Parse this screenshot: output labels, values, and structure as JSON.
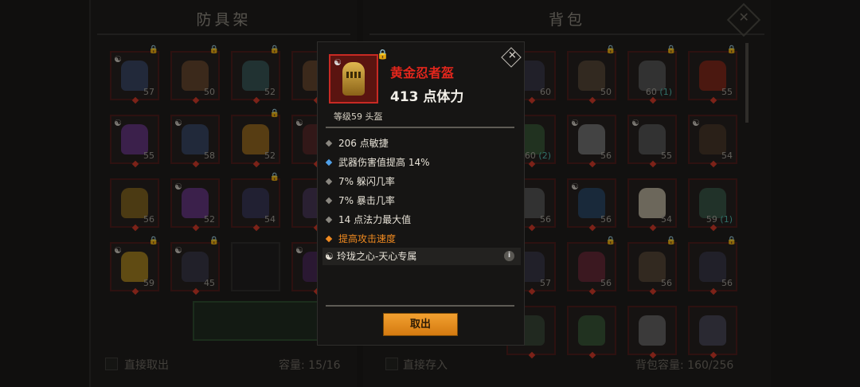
{
  "left_panel": {
    "title": "防具架",
    "footer_checkbox_label": "直接取出",
    "capacity": "容量: 15/16",
    "slots": [
      {
        "level": "57",
        "color": "#3c4a6a",
        "yy": true,
        "lock": true
      },
      {
        "level": "50",
        "color": "#6a4a30",
        "yy": false,
        "lock": true
      },
      {
        "level": "52",
        "color": "#3a5a5a",
        "yy": false,
        "lock": true
      },
      {
        "level": "",
        "color": "#6a4a30",
        "yy": false,
        "lock": true
      },
      {
        "level": "55",
        "color": "#6a3a8a",
        "yy": true,
        "lock": false
      },
      {
        "level": "58",
        "color": "#3a4a6a",
        "yy": true,
        "lock": false
      },
      {
        "level": "52",
        "color": "#a07020",
        "yy": false,
        "lock": true
      },
      {
        "level": "",
        "color": "#5a2a2a",
        "yy": true,
        "lock": false
      },
      {
        "level": "56",
        "color": "#8a6a20",
        "yy": false,
        "lock": false
      },
      {
        "level": "52",
        "color": "#6a3a8a",
        "yy": true,
        "lock": false
      },
      {
        "level": "54",
        "color": "#3a3a5a",
        "yy": false,
        "lock": true
      },
      {
        "level": "",
        "color": "#4a3a5a",
        "yy": false,
        "lock": false
      },
      {
        "level": "59",
        "color": "#b08a20",
        "yy": true,
        "lock": true
      },
      {
        "level": "45",
        "color": "#3a3a4a",
        "yy": true,
        "lock": true
      },
      {
        "level": "",
        "color": "",
        "yy": false,
        "lock": false
      },
      {
        "level": "",
        "color": "#4a2a5a",
        "yy": true,
        "lock": false
      }
    ]
  },
  "right_panel": {
    "title": "背包",
    "footer_checkbox_label": "直接存入",
    "capacity": "背包容量: 160/256",
    "slots": [
      {
        "level": "60",
        "extra": "",
        "color": "#3a3a4a",
        "yy": false,
        "lock": false
      },
      {
        "level": "50",
        "extra": "",
        "color": "#5a4a3a",
        "yy": false,
        "lock": true
      },
      {
        "level": "60",
        "extra": "(1)",
        "color": "#5a5a5a",
        "yy": false,
        "lock": true
      },
      {
        "level": "55",
        "extra": "",
        "color": "#8a2a1a",
        "yy": false,
        "lock": true
      },
      {
        "level": "60",
        "extra": "(2)",
        "color": "#3a5a3a",
        "yy": false,
        "lock": false
      },
      {
        "level": "56",
        "extra": "",
        "color": "#7a7a7a",
        "yy": true,
        "lock": false
      },
      {
        "level": "55",
        "extra": "",
        "color": "#5a5a5a",
        "yy": true,
        "lock": false
      },
      {
        "level": "54",
        "extra": "",
        "color": "#4a3a2a",
        "yy": true,
        "lock": false
      },
      {
        "level": "56",
        "extra": "",
        "color": "#5a5a5a",
        "yy": false,
        "lock": false
      },
      {
        "level": "56",
        "extra": "",
        "color": "#2a4a6a",
        "yy": true,
        "lock": false
      },
      {
        "level": "54",
        "extra": "",
        "color": "#c8c0a8",
        "yy": false,
        "lock": false
      },
      {
        "level": "59",
        "extra": "(1)",
        "color": "#3a5a4a",
        "yy": false,
        "lock": false
      },
      {
        "level": "57",
        "extra": "",
        "color": "#3a3a4a",
        "yy": false,
        "lock": false
      },
      {
        "level": "56",
        "extra": "",
        "color": "#6a2a3a",
        "yy": false,
        "lock": true
      },
      {
        "level": "56",
        "extra": "",
        "color": "#5a4a3a",
        "yy": false,
        "lock": true
      },
      {
        "level": "56",
        "extra": "",
        "color": "#3a3a4a",
        "yy": false,
        "lock": true
      },
      {
        "level": "",
        "extra": "",
        "color": "#3a4a3a",
        "yy": false,
        "lock": false
      },
      {
        "level": "",
        "extra": "",
        "color": "#3a5a3a",
        "yy": false,
        "lock": false
      },
      {
        "level": "",
        "extra": "",
        "color": "#6a6a6a",
        "yy": false,
        "lock": false
      },
      {
        "level": "",
        "extra": "",
        "color": "#4a4a5a",
        "yy": false,
        "lock": false
      }
    ]
  },
  "tooltip": {
    "item_name": "黄金忍者盔",
    "main_stat": "413 点体力",
    "level_type": "等级59 头盔",
    "stats": [
      {
        "text": "206 点敏捷",
        "style": "normal"
      },
      {
        "text": "武器伤害值提高 14%",
        "style": "blue"
      },
      {
        "text": "7% 躲闪几率",
        "style": "normal"
      },
      {
        "text": "7% 暴击几率",
        "style": "normal"
      },
      {
        "text": "14 点法力最大值",
        "style": "normal"
      },
      {
        "text": "提高攻击速度",
        "style": "orange"
      }
    ],
    "set_name": "玲珑之心-天心专属",
    "button_label": "取出",
    "colors": {
      "name": "#e3261c",
      "button": "#e8901c"
    }
  },
  "icons": {
    "yin_yang": "☯",
    "lock": "🔒",
    "close": "✕",
    "info": "i"
  }
}
